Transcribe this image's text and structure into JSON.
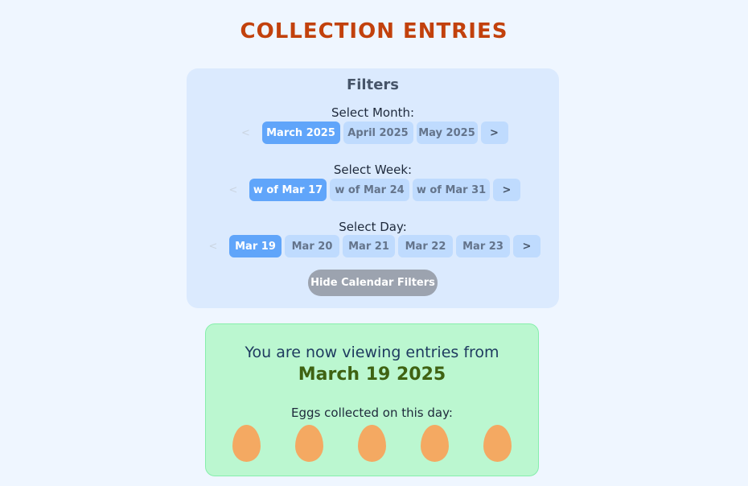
{
  "page": {
    "title": "COLLECTION ENTRIES"
  },
  "filters": {
    "heading": "Filters",
    "month": {
      "label": "Select Month:",
      "prev": "<",
      "next": ">",
      "options": [
        "March 2025",
        "April 2025",
        "May 2025"
      ],
      "selected": "March 2025"
    },
    "week": {
      "label": "Select Week:",
      "prev": "<",
      "next": ">",
      "options": [
        "w of Mar 17",
        "w of Mar 24",
        "w of Mar 31"
      ],
      "selected": "w of Mar 17"
    },
    "day": {
      "label": "Select Day:",
      "prev": "<",
      "next": ">",
      "options": [
        "Mar 19",
        "Mar 20",
        "Mar 21",
        "Mar 22",
        "Mar 23"
      ],
      "selected": "Mar 19"
    },
    "hide_button": "Hide Calendar Filters"
  },
  "viewing": {
    "intro": "You are now viewing entries from",
    "date": "March 19 2025",
    "eggs_label": "Eggs collected on this day:",
    "egg_count": 5,
    "egg_color": "#f4a962"
  },
  "colors": {
    "title": "#c2410c",
    "active_pill": "#60a5fa",
    "inactive_pill": "#bfdbfe",
    "filters_bg": "#dbeafe",
    "viewing_bg": "#bbf7d0",
    "date_text": "#3f6212"
  }
}
